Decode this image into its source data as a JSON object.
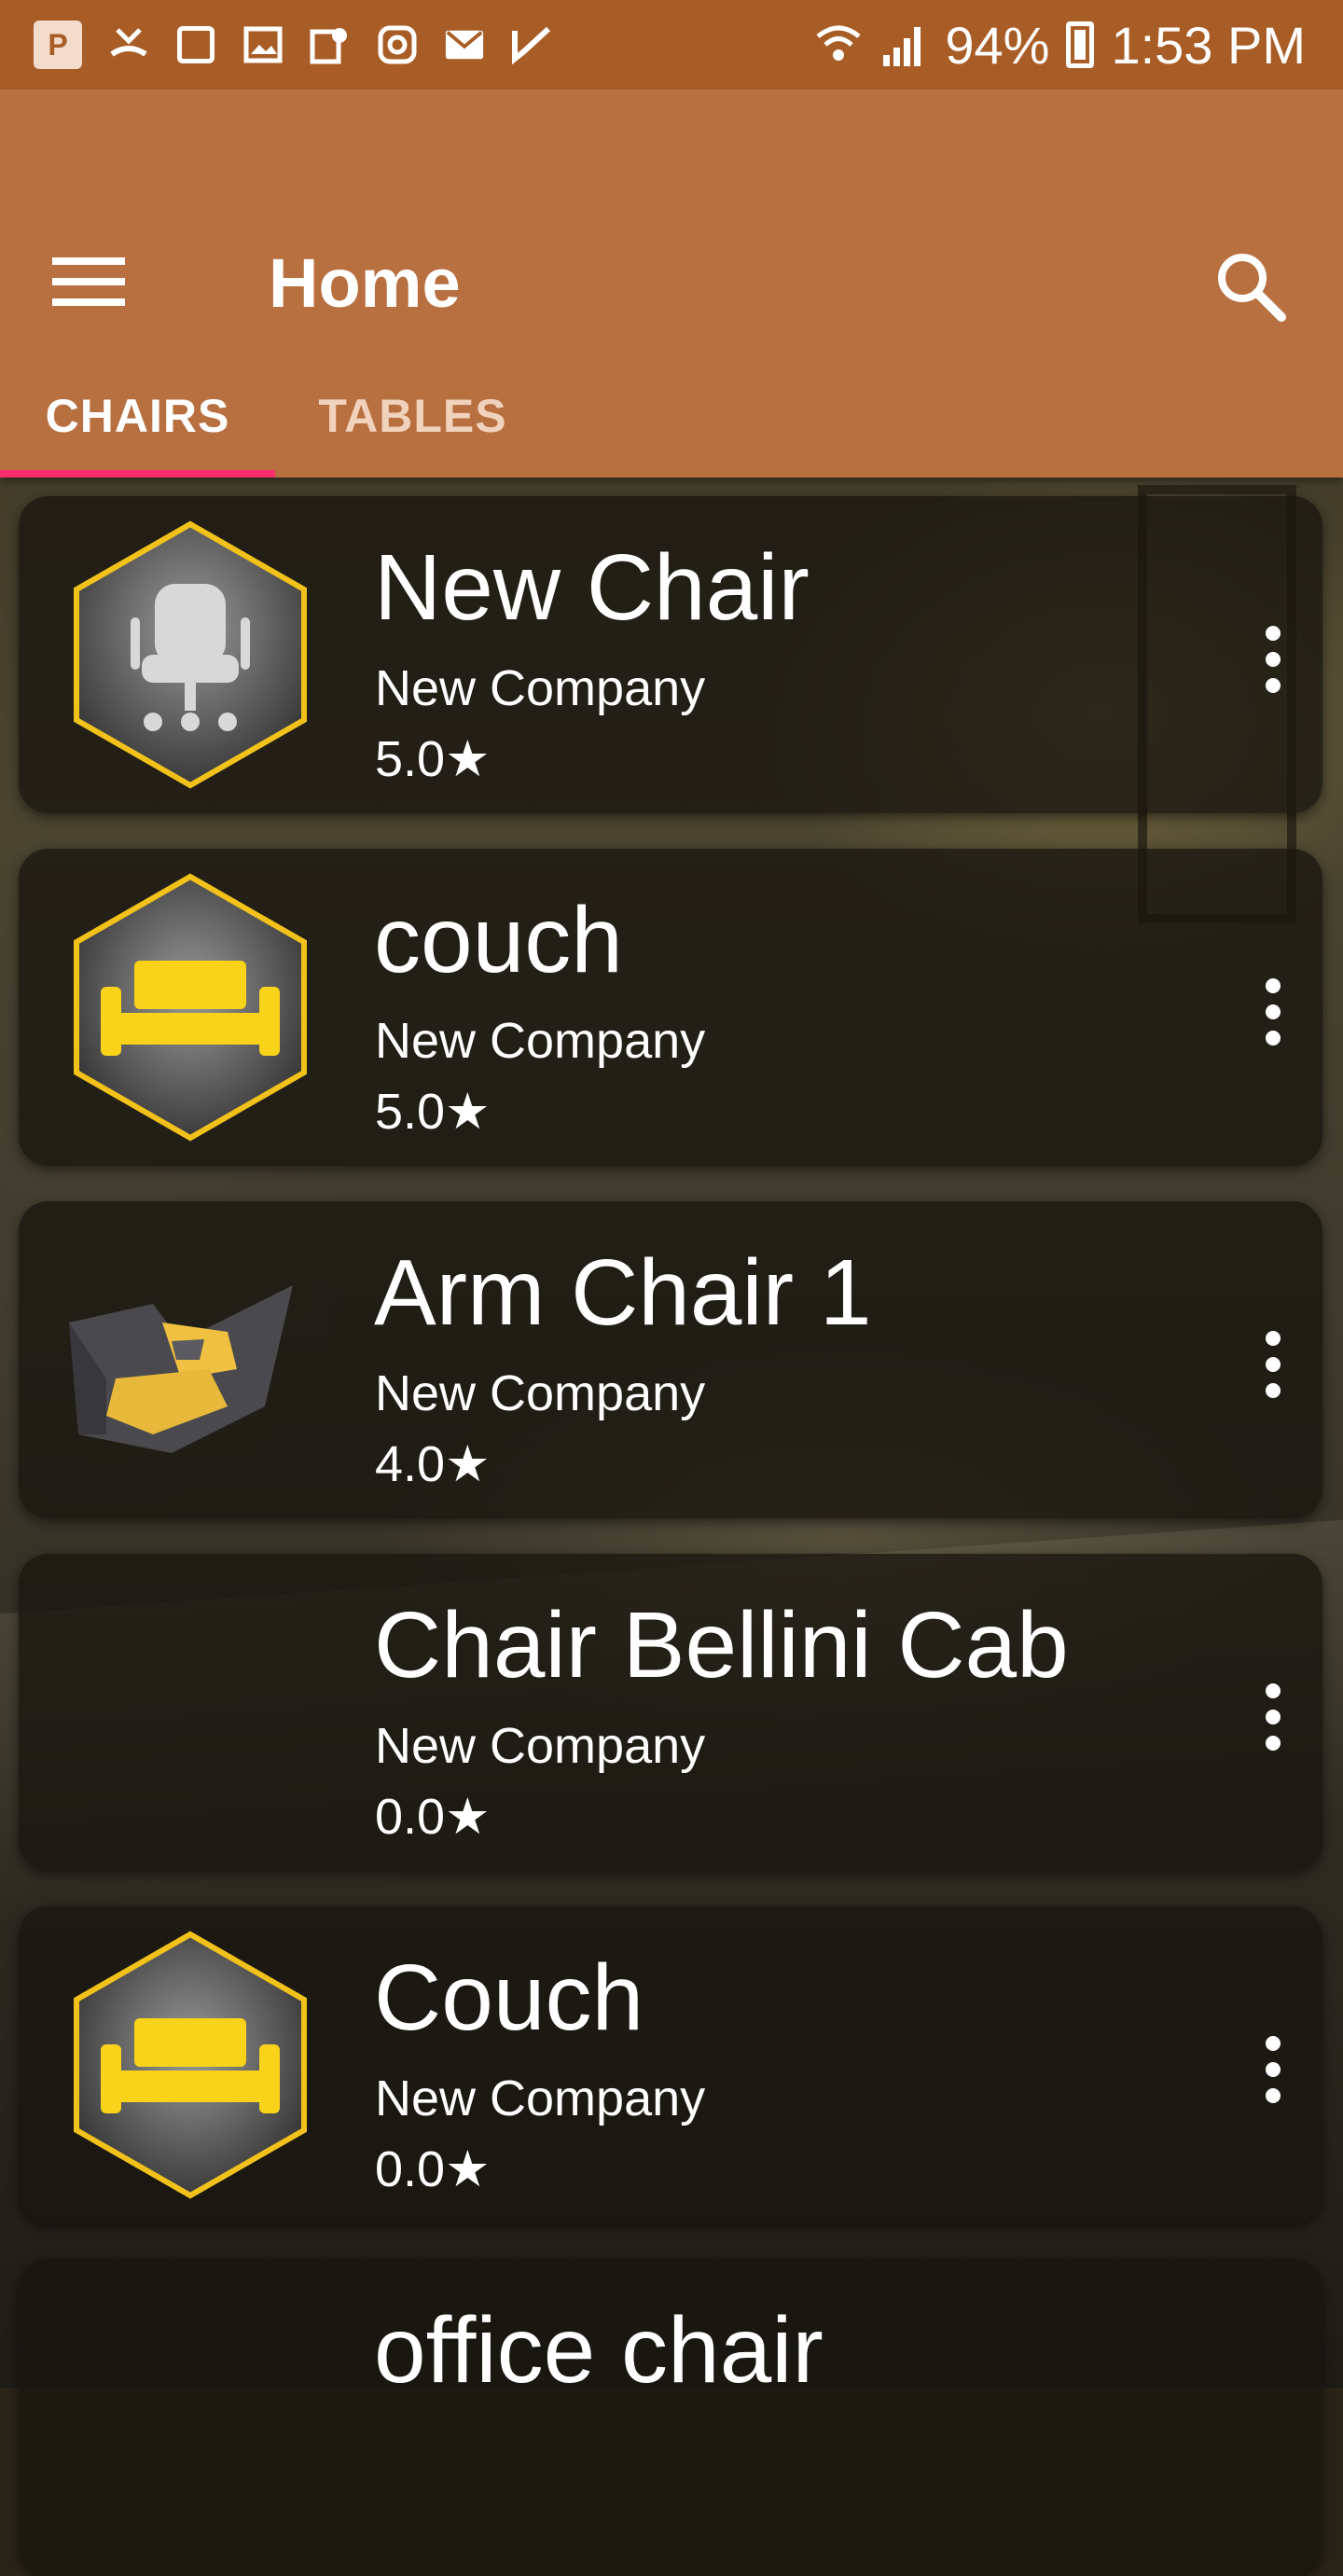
{
  "status_bar": {
    "battery": "94%",
    "time": "1:53 PM",
    "left_icons": [
      "app-p-icon",
      "missed-call-icon",
      "screen-sync-icon",
      "image-icon",
      "maps-icon",
      "instagram-icon",
      "email-icon",
      "check-icon"
    ],
    "right_icons": [
      "wifi-icon",
      "signal-icon",
      "battery-charging-icon"
    ]
  },
  "app_bar": {
    "title": "Home",
    "menu_icon": "menu-icon",
    "search_icon": "search-icon",
    "background_color": "#b87040",
    "status_bar_color": "#a95d26"
  },
  "tabs": [
    {
      "label": "CHAIRS",
      "selected": true
    },
    {
      "label": "TABLES",
      "selected": false
    }
  ],
  "accent_color": "#ff2d6b",
  "items": [
    {
      "name": "New Chair",
      "company": "New Company",
      "rating": "5.0★",
      "icon": "office-chair-hex-icon"
    },
    {
      "name": "couch",
      "company": "New Company",
      "rating": "5.0★",
      "icon": "couch-hex-icon"
    },
    {
      "name": "Arm Chair 1",
      "company": "New Company",
      "rating": "4.0★",
      "icon": "arm-chair-photo"
    },
    {
      "name": "Chair Bellini Cab",
      "company": "New Company",
      "rating": "0.0★",
      "icon": ""
    },
    {
      "name": "Couch",
      "company": "New Company",
      "rating": "0.0★",
      "icon": "couch-hex-icon"
    },
    {
      "name": "office chair",
      "company": "",
      "rating": "",
      "icon": ""
    }
  ]
}
